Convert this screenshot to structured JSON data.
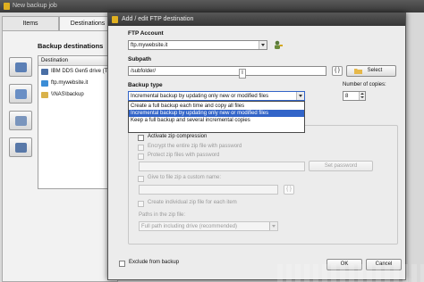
{
  "back_window": {
    "title": "New backup job",
    "tabs": [
      "Items",
      "Destinations"
    ],
    "section_title": "Backup destinations",
    "table_header": "Destination",
    "rows": [
      {
        "label": "IBM DDS Gen5 drive (TA",
        "icon": "tape-drive-icon",
        "color": "#4a6fa5"
      },
      {
        "label": "ftp.mywebsite.it",
        "icon": "ftp-server-icon",
        "color": "#3c8dd6"
      },
      {
        "label": "\\\\NAS\\backup",
        "icon": "network-share-icon",
        "color": "#d9b24a"
      }
    ]
  },
  "dialog": {
    "title": "Add / edit FTP destination",
    "ftp_account": {
      "label": "FTP Account",
      "value": "ftp.mywebsite.it"
    },
    "subpath": {
      "label": "Subpath",
      "value": "/subfolder/",
      "braces": "{ }",
      "select_label": "Select"
    },
    "backup_type": {
      "label": "Backup type",
      "value": "Incremental backup by updating only new or modified files",
      "options": [
        "Create a full backup each time and copy all files",
        "Incremental backup by updating only new or modified files",
        "Keep a full backup and several incremental copies"
      ],
      "selected_index": 1
    },
    "copies": {
      "label": "Number of copies:",
      "value": "8"
    },
    "zip": {
      "activate": "Activate zip compression",
      "encrypt": "Encrypt the entire zip file with password",
      "protect": "Protect zip files with password",
      "password_placeholder": "",
      "set_password": "Set password",
      "custom_name": "Give to file zip a custom name:",
      "custom_braces": "{ }",
      "individual": "Create individual zip file for each item",
      "paths_label": "Paths in the zip file:",
      "paths_value": "Full path including drive (recommended)",
      "format_letter": "I"
    },
    "exclude": "Exclude from backup",
    "ok": "OK",
    "cancel": "Cancel"
  },
  "colors": {
    "selection": "#3264c8",
    "titlebar": "#3a3a3a",
    "dialog_bg": "#ececec"
  }
}
